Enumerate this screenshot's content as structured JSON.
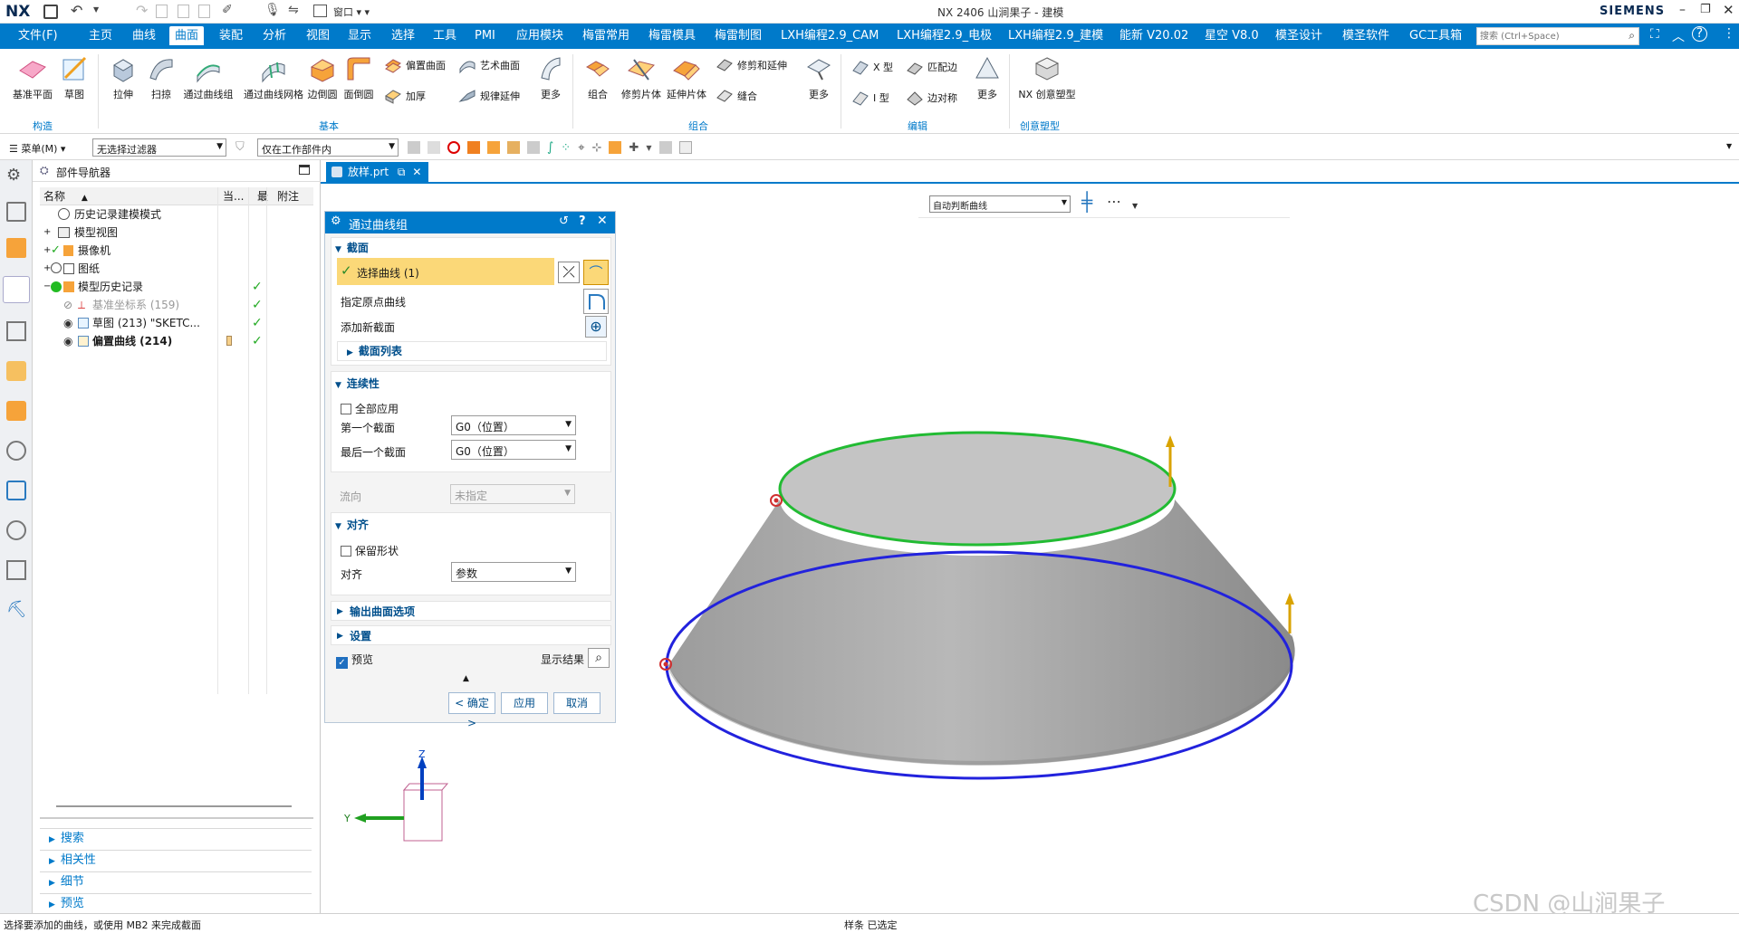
{
  "title": {
    "logo": "NX",
    "window_menu": "窗口",
    "app_title": "NX 2406 山涧果子 - 建模",
    "brand": "SIEMENS"
  },
  "menu": {
    "file": "文件(F)",
    "items": [
      "主页",
      "曲线",
      "曲面",
      "装配",
      "分析",
      "视图",
      "显示",
      "选择",
      "工具",
      "PMI",
      "应用模块",
      "梅雷常用",
      "梅雷模具",
      "梅雷制图",
      "LXH编程2.9_CAM",
      "LXH编程2.9_电极",
      "LXH编程2.9_建模",
      "能新 V20.02",
      "星空 V8.0",
      "模圣设计",
      "模圣软件",
      "GC工具箱"
    ],
    "active": "曲面",
    "search_placeholder": "搜索 (Ctrl+Space)"
  },
  "ribbon": {
    "construct": {
      "datum_plane": "基准平面",
      "sketch": "草图",
      "group": "构造"
    },
    "basic": {
      "extrude": "拉伸",
      "sweep": "扫掠",
      "through_curves": "通过曲线组",
      "through_curve_mesh": "通过曲线网格",
      "edge_blend": "边倒圆",
      "face_blend": "面倒圆",
      "offset_surface": "偏置曲面",
      "thicken": "加厚",
      "studio_surface": "艺术曲面",
      "law_extension": "规律延伸",
      "more": "更多",
      "group": "基本"
    },
    "combine": {
      "unite": "组合",
      "trim_sheet": "修剪片体",
      "extend_sheet": "延伸片体",
      "trim_extend": "修剪和延伸",
      "sew": "缝合",
      "more": "更多",
      "group": "组合"
    },
    "edit": {
      "x_type": "X 型",
      "i_type": "I 型",
      "match_edge": "匹配边",
      "edge_symmetry": "边对称",
      "more": "更多",
      "group": "编辑"
    },
    "creative": {
      "nx_creative": "NX 创意塑型",
      "group": "创意塑型"
    }
  },
  "filterbar": {
    "menu": "菜单(M)",
    "type_filter": "无选择过滤器",
    "scope": "仅在工作部件内"
  },
  "navigator": {
    "title": "部件导航器",
    "columns": {
      "name": "名称",
      "current": "当...",
      "latest": "最",
      "note": "附注"
    },
    "rows": [
      {
        "label": "历史记录建模模式"
      },
      {
        "label": "模型视图"
      },
      {
        "label": "摄像机"
      },
      {
        "label": "图纸"
      },
      {
        "label": "模型历史记录"
      },
      {
        "label": "基准坐标系 (159)"
      },
      {
        "label": "草图 (213) \"SKETC..."
      },
      {
        "label": "偏置曲线 (214)"
      }
    ],
    "bottom_sections": [
      "搜索",
      "相关性",
      "细节",
      "预览"
    ]
  },
  "tab": {
    "file": "放样.prt"
  },
  "view_toolbar": {
    "curve_rule": "自动判断曲线"
  },
  "dialog": {
    "title": "通过曲线组",
    "section_header": "截面",
    "select_curve": "选择曲线 (1)",
    "specify_origin": "指定原点曲线",
    "add_section": "添加新截面",
    "section_list": "截面列表",
    "continuity_header": "连续性",
    "apply_all": "全部应用",
    "first_section": "第一个截面",
    "first_value": "G0（位置）",
    "last_section": "最后一个截面",
    "last_value": "G0（位置）",
    "flow_direction": "流向",
    "flow_value": "未指定",
    "alignment_header": "对齐",
    "keep_shape": "保留形状",
    "alignment_label": "对齐",
    "alignment_value": "参数",
    "output_options": "输出曲面选项",
    "settings": "设置",
    "preview": "预览",
    "show_result": "显示结果",
    "ok": "< 确定 >",
    "apply": "应用",
    "cancel": "取消"
  },
  "triad": {
    "z": "Z",
    "y": "Y"
  },
  "status": {
    "prompt": "选择要添加的曲线，或使用 MB2 来完成截面",
    "selection": "样条 已选定"
  },
  "watermark": "CSDN @山涧果子",
  "colors": {
    "accent": "#007aca",
    "highlight": "#fbd878",
    "green_curve": "#22bb33",
    "blue_curve": "#2222dd"
  }
}
